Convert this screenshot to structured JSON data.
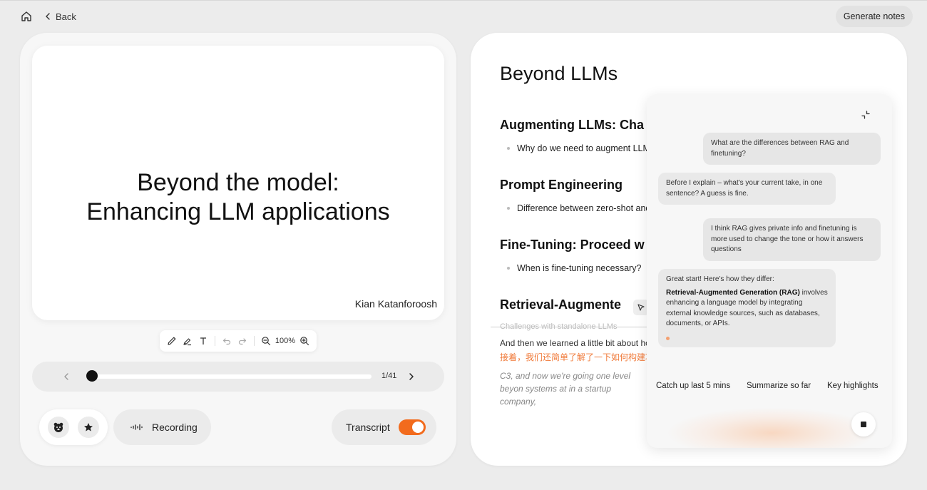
{
  "header": {
    "back_label": "Back",
    "generate_label": "Generate notes"
  },
  "slide": {
    "title_line1": "Beyond the model:",
    "title_line2": "Enhancing LLM applications",
    "author": "Kian Katanforoosh"
  },
  "toolbar": {
    "zoom": "100%"
  },
  "slide_nav": {
    "current_page": 1,
    "total_pages": 41,
    "page_label": "1/41",
    "progress": 0.0
  },
  "controls": {
    "recording_label": "Recording",
    "transcript_label": "Transcript",
    "transcript_on": true
  },
  "doc": {
    "title": "Beyond LLMs",
    "sections": [
      {
        "heading": "Augmenting LLMs: Cha",
        "bullet": "Why do we need to augment LLM"
      },
      {
        "heading": "Prompt Engineering",
        "bullet": "Difference between zero-shot and"
      },
      {
        "heading": "Fine-Tuning: Proceed w",
        "bullet": "When is fine-tuning necessary?"
      },
      {
        "heading": "Retrieval-Augmente"
      }
    ],
    "transcript": {
      "ghost": "Challenges with standalone LLMs",
      "english": "And then we learned a little bit about ho",
      "chinese": "接着，我们还简单了解了一下如何构建项",
      "italic": "C3, and now we're going one level beyon systems at in a startup company,"
    }
  },
  "chat": {
    "messages": [
      {
        "role": "user",
        "text": "What are the differences between RAG and finetuning?"
      },
      {
        "role": "assistant",
        "text": "Before I explain – what's your current take, in one sentence? A guess is fine."
      },
      {
        "role": "user",
        "text": "I think RAG gives private info and finetuning is more used to change the tone or how it answers questions"
      },
      {
        "role": "assistant",
        "intro": "Great start! Here's how they differ:",
        "bold": "Retrieval-Augmented Generation (RAG)",
        "rest": " involves enhancing a language model by integrating external knowledge sources, such as databases, documents, or APIs."
      }
    ],
    "quick_actions": [
      "Catch up last 5 mins",
      "Summarize so far",
      "Key highlights"
    ]
  },
  "colors": {
    "accent": "#f26b1d",
    "background": "#ececec",
    "chinese_text": "#f07a3a"
  },
  "icons": [
    "home-icon",
    "chevron-left-icon",
    "pencil-icon",
    "highlighter-icon",
    "text-icon",
    "undo-icon",
    "redo-icon",
    "zoom-out-icon",
    "zoom-in-icon",
    "chevron-right-icon",
    "bear-icon",
    "star-icon",
    "waveform-icon",
    "cursor-icon",
    "collapse-icon",
    "stop-icon"
  ]
}
